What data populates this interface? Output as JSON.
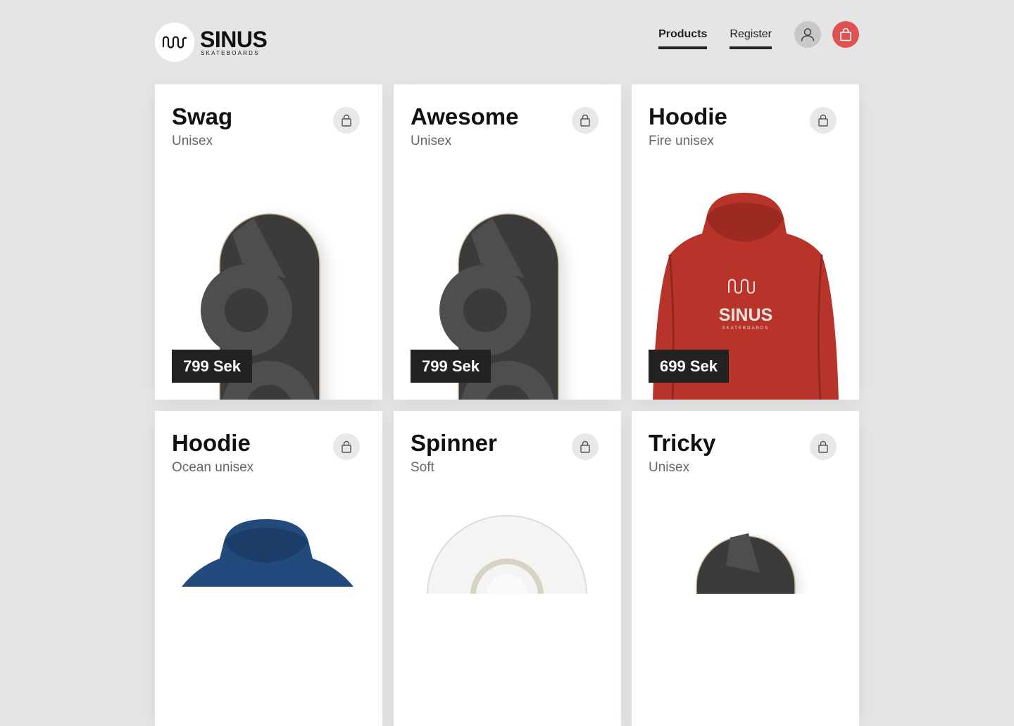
{
  "brand": {
    "name": "SINUS",
    "tagline": "SKATEBOARDS"
  },
  "nav": {
    "products_label": "Products",
    "register_label": "Register"
  },
  "icons": {
    "logo": "wave-logo-icon",
    "user": "user-icon",
    "cart": "shopping-bag-icon",
    "favorite": "lock-icon"
  },
  "colors": {
    "background": "#e5e5e5",
    "accent": "#e05252",
    "price_bg": "#222222",
    "hoodie_red": "#b8342a",
    "hoodie_blue": "#234a7c",
    "deck_grey": "#3b3b3b"
  },
  "products": [
    {
      "title": "Swag",
      "subtitle": "Unisex",
      "price": "799 Sek",
      "image": "skateboard-deck"
    },
    {
      "title": "Awesome",
      "subtitle": "Unisex",
      "price": "799 Sek",
      "image": "skateboard-deck"
    },
    {
      "title": "Hoodie",
      "subtitle": "Fire unisex",
      "price": "699 Sek",
      "image": "red-hoodie"
    },
    {
      "title": "Hoodie",
      "subtitle": "Ocean unisex",
      "image": "blue-hoodie"
    },
    {
      "title": "Spinner",
      "subtitle": "Soft",
      "image": "white-wheel"
    },
    {
      "title": "Tricky",
      "subtitle": "Unisex",
      "image": "skateboard-deck"
    }
  ]
}
